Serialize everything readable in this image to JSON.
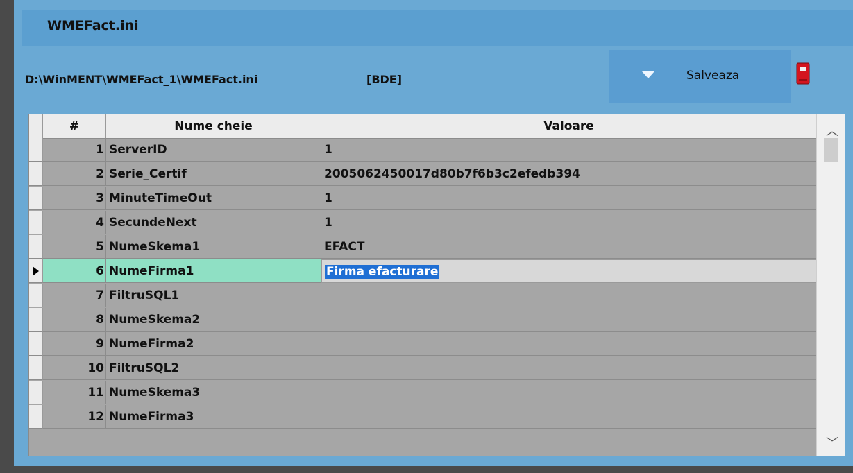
{
  "window": {
    "title": "WMEFact.ini"
  },
  "info": {
    "path": "D:\\WinMENT\\WMEFact_1\\WMEFact.ini",
    "driver": "[BDE]"
  },
  "toolbar": {
    "save_label": "Salveaza",
    "exit_icon": "exit-door-icon"
  },
  "grid": {
    "columns": [
      "#",
      "Nume cheie",
      "Valoare"
    ],
    "rows": [
      {
        "num": "1",
        "key": "ServerID",
        "value": "1"
      },
      {
        "num": "2",
        "key": "Serie_Certif",
        "value": "2005062450017d80b7f6b3c2efedb394"
      },
      {
        "num": "3",
        "key": "MinuteTimeOut",
        "value": "1"
      },
      {
        "num": "4",
        "key": "SecundeNext",
        "value": "1"
      },
      {
        "num": "5",
        "key": "NumeSkema1",
        "value": "EFACT"
      },
      {
        "num": "6",
        "key": "NumeFirma1",
        "value": "Firma efacturare"
      },
      {
        "num": "7",
        "key": "FiltruSQL1",
        "value": ""
      },
      {
        "num": "8",
        "key": "NumeSkema2",
        "value": ""
      },
      {
        "num": "9",
        "key": "NumeFirma2",
        "value": ""
      },
      {
        "num": "10",
        "key": "FiltruSQL2",
        "value": ""
      },
      {
        "num": "11",
        "key": "NumeSkema3",
        "value": ""
      },
      {
        "num": "12",
        "key": "NumeFirma3",
        "value": ""
      }
    ],
    "active_row": "6"
  },
  "colors": {
    "panel": "#6aa9d4",
    "active_row": "#8fe0c4",
    "selection": "#1f6fd4"
  }
}
